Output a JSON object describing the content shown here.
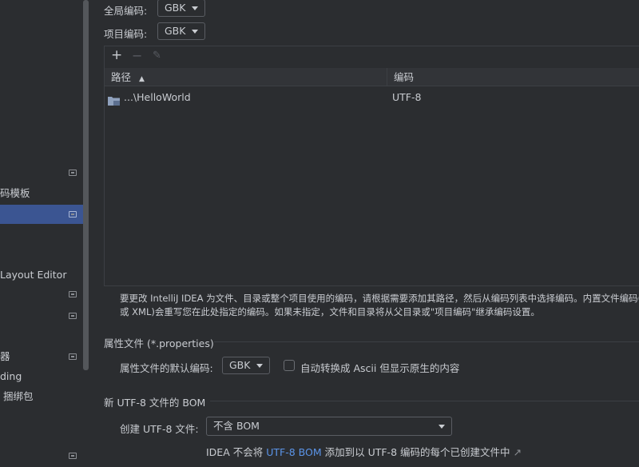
{
  "sidebar": {
    "items": [
      {
        "label": "",
        "pin": true,
        "selected": false
      },
      {
        "label": "码模板",
        "pin": false,
        "selected": false
      },
      {
        "label": "",
        "pin": true,
        "selected": true
      },
      {
        "label": "Layout Editor",
        "pin": false,
        "selected": false
      },
      {
        "label": "",
        "pin": true,
        "selected": false
      },
      {
        "label": "",
        "pin": true,
        "selected": false
      },
      {
        "label": "器",
        "pin": true,
        "selected": false
      },
      {
        "label": "ding",
        "pin": false,
        "selected": false
      },
      {
        "label": " 捆绑包",
        "pin": false,
        "selected": false
      }
    ]
  },
  "global_encoding": {
    "label": "全局编码:",
    "value": "GBK"
  },
  "project_encoding": {
    "label": "项目编码:",
    "value": "GBK"
  },
  "table": {
    "toolbar": {
      "add": "+",
      "remove": "−",
      "edit": "✎"
    },
    "columns": {
      "path": "路径",
      "encoding": "编码"
    },
    "sort_indicator": "▲",
    "rows": [
      {
        "path": "...\\HelloWorld",
        "encoding": "UTF-8"
      }
    ]
  },
  "description": {
    "line1": "要更改 IntelliJ IDEA 为文件、目录或整个项目使用的编码，请根据需要添加其路径，然后从编码列表中选择编码。内置文件编码(例如",
    "line2": "或 XML)会重写您在此处指定的编码。如果未指定，文件和目录将从父目录或\"项目编码\"继承编码设置。"
  },
  "properties": {
    "section_title": "属性文件 (*.properties)",
    "default_label": "属性文件的默认编码:",
    "default_value": "GBK",
    "ascii_checkbox_label": "自动转换成 Ascii 但显示原生的内容",
    "ascii_checked": false
  },
  "bom": {
    "section_title": "新 UTF-8 文件的 BOM",
    "create_label": "创建 UTF-8 文件:",
    "create_value": "不含 BOM",
    "note_prefix": "IDEA 不会将",
    "note_link": "UTF-8 BOM",
    "note_suffix": "添加到以 UTF-8 编码的每个已创建文件中",
    "note_arrow": "↗"
  },
  "colors": {
    "accent": "#3b5592",
    "link": "#5b94e8"
  }
}
